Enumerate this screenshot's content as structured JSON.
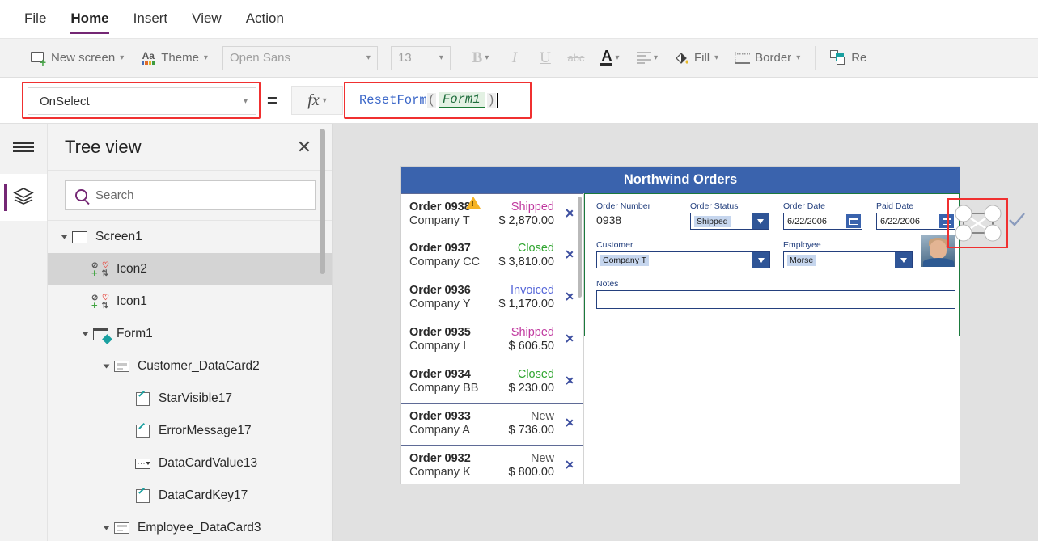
{
  "menu": {
    "items": [
      {
        "label": "File",
        "active": false
      },
      {
        "label": "Home",
        "active": true
      },
      {
        "label": "Insert",
        "active": false
      },
      {
        "label": "View",
        "active": false
      },
      {
        "label": "Action",
        "active": false
      }
    ]
  },
  "ribbon": {
    "new_screen": "New screen",
    "theme": "Theme",
    "font_name": "Open Sans",
    "font_size": "13",
    "bold": "B",
    "italic": "I",
    "underline": "U",
    "strikethrough": "abc",
    "font_color": "A",
    "align": "align-icon",
    "fill": "Fill",
    "border": "Border",
    "reorder": "Re"
  },
  "formula_bar": {
    "property": "OnSelect",
    "equals": "=",
    "fx": "fx",
    "formula_fn": "ResetForm",
    "formula_open_paren": "(",
    "formula_arg": "Form1",
    "formula_close_paren": ")",
    "highlight_color": "#f03030"
  },
  "tree": {
    "title": "Tree view",
    "close": "✕",
    "search_placeholder": "Search",
    "nodes": [
      {
        "label": "Screen1",
        "indent": 0,
        "icon": "screen",
        "expander": true,
        "selected": false
      },
      {
        "label": "Icon2",
        "indent": 1,
        "icon": "icon-quad",
        "expander": false,
        "selected": true
      },
      {
        "label": "Icon1",
        "indent": 1,
        "icon": "icon-quad",
        "expander": false,
        "selected": false
      },
      {
        "label": "Form1",
        "indent": 1,
        "icon": "form",
        "expander": true,
        "selected": false
      },
      {
        "label": "Customer_DataCard2",
        "indent": 2,
        "icon": "card",
        "expander": true,
        "selected": false
      },
      {
        "label": "StarVisible17",
        "indent": 3,
        "icon": "pen",
        "expander": false,
        "selected": false
      },
      {
        "label": "ErrorMessage17",
        "indent": 3,
        "icon": "pen",
        "expander": false,
        "selected": false
      },
      {
        "label": "DataCardValue13",
        "indent": 3,
        "icon": "dropdown",
        "expander": false,
        "selected": false
      },
      {
        "label": "DataCardKey17",
        "indent": 3,
        "icon": "pen",
        "expander": false,
        "selected": false
      },
      {
        "label": "Employee_DataCard3",
        "indent": 2,
        "icon": "card",
        "expander": true,
        "selected": false
      }
    ]
  },
  "canvas": {
    "app_title": "Northwind Orders",
    "header_color": "#3a63ad",
    "gallery": [
      {
        "order": "Order 0938",
        "company": "Company T",
        "status": "Shipped",
        "status_color": "#c0399f",
        "amount": "$ 2,870.00",
        "warning": true
      },
      {
        "order": "Order 0937",
        "company": "Company CC",
        "status": "Closed",
        "status_color": "#2fa52f",
        "amount": "$ 3,810.00",
        "warning": false
      },
      {
        "order": "Order 0936",
        "company": "Company Y",
        "status": "Invoiced",
        "status_color": "#5566d8",
        "amount": "$ 1,170.00",
        "warning": false
      },
      {
        "order": "Order 0935",
        "company": "Company I",
        "status": "Shipped",
        "status_color": "#c0399f",
        "amount": "$ 606.50",
        "warning": false
      },
      {
        "order": "Order 0934",
        "company": "Company BB",
        "status": "Closed",
        "status_color": "#2fa52f",
        "amount": "$ 230.00",
        "warning": false
      },
      {
        "order": "Order 0933",
        "company": "Company A",
        "status": "New",
        "status_color": "#555555",
        "amount": "$ 736.00",
        "warning": false
      },
      {
        "order": "Order 0932",
        "company": "Company K",
        "status": "New",
        "status_color": "#555555",
        "amount": "$ 800.00",
        "warning": false
      }
    ],
    "form": {
      "border_color": "#1b7a3d",
      "order_number_label": "Order Number",
      "order_number_value": "0938",
      "order_status_label": "Order Status",
      "order_status_value": "Shipped",
      "order_date_label": "Order Date",
      "order_date_value": "6/22/2006",
      "paid_date_label": "Paid Date",
      "paid_date_value": "6/22/2006",
      "customer_label": "Customer",
      "customer_value": "Company T",
      "employee_label": "Employee",
      "employee_value": "Morse",
      "notes_label": "Notes",
      "notes_value": ""
    }
  }
}
